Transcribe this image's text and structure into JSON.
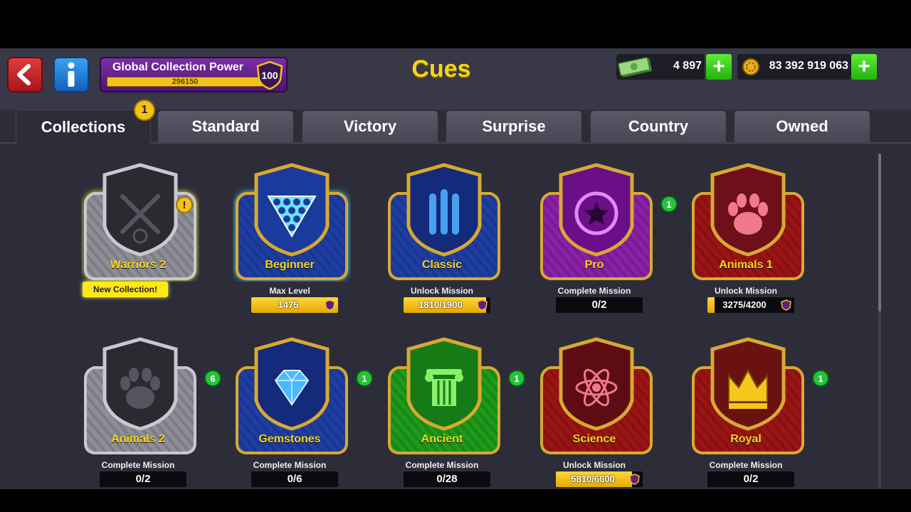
{
  "header": {
    "title": "Cues",
    "power_label": "Global Collection Power",
    "power_value": "296150",
    "power_level": "100",
    "cash_value": "4 897",
    "coins_value": "83 392 919 063"
  },
  "tabs": [
    {
      "label": "Collections",
      "badge": "1"
    },
    {
      "label": "Standard"
    },
    {
      "label": "Victory"
    },
    {
      "label": "Surprise"
    },
    {
      "label": "Country"
    },
    {
      "label": "Owned"
    }
  ],
  "collections": [
    {
      "name": "Warriors 2",
      "subtitle": "",
      "tag": "New Collection!",
      "badge": "!",
      "locked": true,
      "progress": null,
      "icon": "crossed-swords-icon"
    },
    {
      "name": "Beginner",
      "subtitle": "Max Level",
      "progress": "1475",
      "fill": 1.0,
      "icon": "ball-rack-icon"
    },
    {
      "name": "Classic",
      "subtitle": "Unlock Mission",
      "progress": "1810/1900",
      "fill": 0.95,
      "icon": "cue-sticks-icon"
    },
    {
      "name": "Pro",
      "subtitle": "Complete Mission",
      "progress": "0/2",
      "badge": "1",
      "icon": "star-medal-icon"
    },
    {
      "name": "Animals 1",
      "subtitle": "Unlock Mission",
      "progress": "3275/4200",
      "fill": 0.08,
      "icon": "paw-icon"
    },
    {
      "name": "Animals 2",
      "subtitle": "Complete Mission",
      "progress": "0/2",
      "badge": "6",
      "locked": true,
      "icon": "paw-icon"
    },
    {
      "name": "Gemstones",
      "subtitle": "Complete Mission",
      "progress": "0/6",
      "badge": "1",
      "icon": "diamond-icon"
    },
    {
      "name": "Ancient",
      "subtitle": "Complete Mission",
      "progress": "0/28",
      "badge": "1",
      "icon": "column-icon"
    },
    {
      "name": "Science",
      "subtitle": "Unlock Mission",
      "progress": "5810/6600",
      "fill": 0.88,
      "icon": "atom-icon"
    },
    {
      "name": "Royal",
      "subtitle": "Complete Mission",
      "progress": "0/2",
      "badge": "1",
      "icon": "crown-icon"
    }
  ],
  "colors": {
    "accent": "#f5d51a",
    "badge_green": "#27c23a",
    "badge_yellow": "#f4c217"
  }
}
